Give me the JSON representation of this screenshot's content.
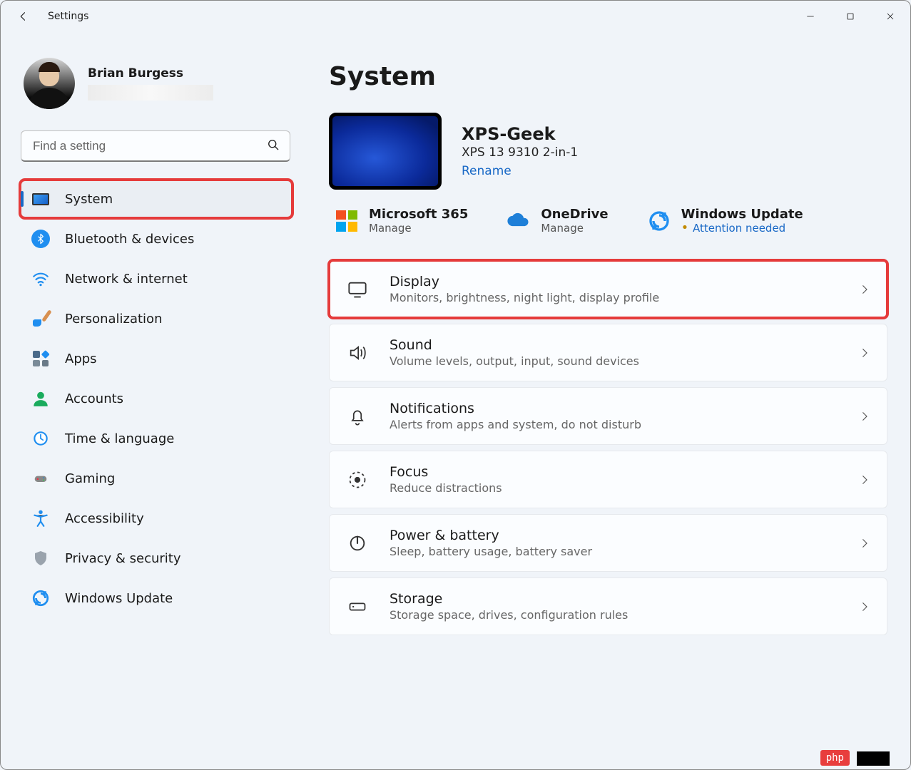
{
  "window": {
    "title": "Settings"
  },
  "profile": {
    "name": "Brian Burgess"
  },
  "search": {
    "placeholder": "Find a setting"
  },
  "sidebar": {
    "items": [
      {
        "label": "System",
        "icon": "system-icon",
        "selected": true,
        "highlighted": true
      },
      {
        "label": "Bluetooth & devices",
        "icon": "bluetooth-icon"
      },
      {
        "label": "Network & internet",
        "icon": "wifi-icon"
      },
      {
        "label": "Personalization",
        "icon": "paintbrush-icon"
      },
      {
        "label": "Apps",
        "icon": "apps-icon"
      },
      {
        "label": "Accounts",
        "icon": "person-icon"
      },
      {
        "label": "Time & language",
        "icon": "globe-clock-icon"
      },
      {
        "label": "Gaming",
        "icon": "gamepad-icon"
      },
      {
        "label": "Accessibility",
        "icon": "accessibility-icon"
      },
      {
        "label": "Privacy & security",
        "icon": "shield-icon"
      },
      {
        "label": "Windows Update",
        "icon": "update-icon"
      }
    ]
  },
  "page": {
    "title": "System",
    "device": {
      "name": "XPS-Geek",
      "model": "XPS 13 9310 2-in-1",
      "rename": "Rename"
    },
    "services": [
      {
        "title": "Microsoft 365",
        "sub": "Manage",
        "icon": "ms365-icon"
      },
      {
        "title": "OneDrive",
        "sub": "Manage",
        "icon": "onedrive-icon"
      },
      {
        "title": "Windows Update",
        "sub": "Attention needed",
        "icon": "update-icon",
        "attention": true
      }
    ],
    "cards": [
      {
        "title": "Display",
        "sub": "Monitors, brightness, night light, display profile",
        "icon": "display-icon",
        "highlighted": true,
        "cursor": true
      },
      {
        "title": "Sound",
        "sub": "Volume levels, output, input, sound devices",
        "icon": "sound-icon"
      },
      {
        "title": "Notifications",
        "sub": "Alerts from apps and system, do not disturb",
        "icon": "bell-icon"
      },
      {
        "title": "Focus",
        "sub": "Reduce distractions",
        "icon": "focus-icon"
      },
      {
        "title": "Power & battery",
        "sub": "Sleep, battery usage, battery saver",
        "icon": "power-icon"
      },
      {
        "title": "Storage",
        "sub": "Storage space, drives, configuration rules",
        "icon": "storage-icon"
      }
    ]
  },
  "badge": "php"
}
